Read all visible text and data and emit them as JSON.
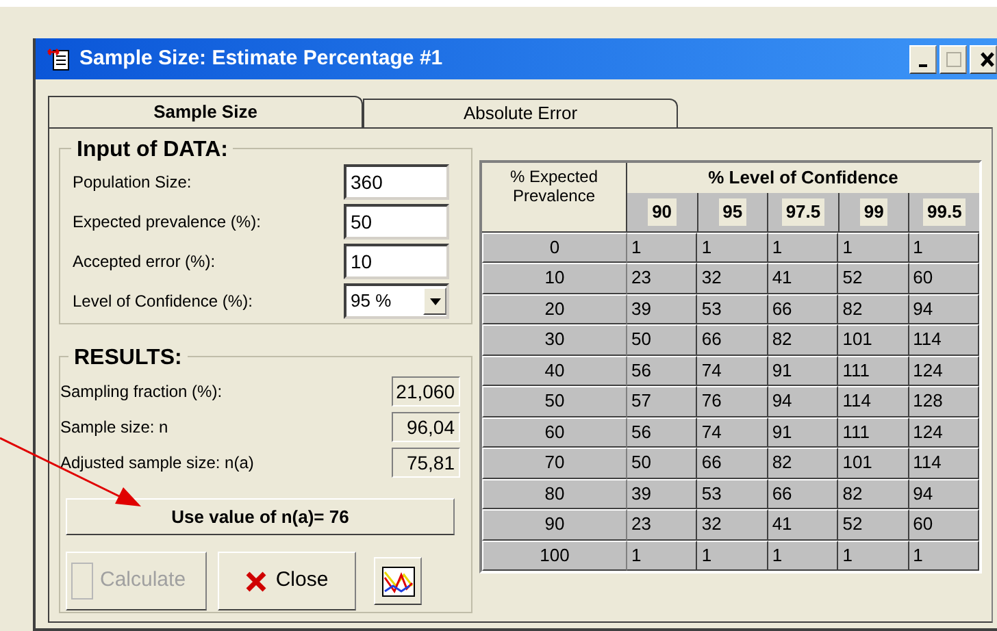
{
  "window": {
    "title": "Sample Size: Estimate Percentage  #1"
  },
  "tabs": [
    {
      "label": "Sample Size",
      "selected": true
    },
    {
      "label": "Absolute Error",
      "selected": false
    }
  ],
  "input": {
    "title": "Input of DATA:",
    "fields": [
      {
        "kind": "text",
        "label": "Population Size:",
        "value": "360"
      },
      {
        "kind": "text",
        "label": "Expected prevalence (%):",
        "value": "50"
      },
      {
        "kind": "text",
        "label": "Accepted error (%):",
        "value": "10"
      },
      {
        "kind": "select",
        "label": "Level of Confidence (%):",
        "value": "95 %"
      }
    ]
  },
  "results": {
    "title": "RESULTS:",
    "rows": [
      {
        "label": "Sampling fraction (%):",
        "value": "21,060"
      },
      {
        "label": "Sample size: n",
        "value": "96,04"
      },
      {
        "label": "Adjusted sample size: n(a)",
        "value": "75,81"
      }
    ],
    "use_button": "Use value of n(a)= 76"
  },
  "buttons": [
    {
      "kind": "calculate",
      "label": "Calculate",
      "disabled": true
    },
    {
      "kind": "close",
      "label": "Close",
      "disabled": false
    },
    {
      "kind": "chart",
      "disabled": false
    }
  ],
  "table": {
    "row_header": "% Expected Prevalence",
    "group_header": "% Level of Confidence",
    "columns": [
      "90",
      "95",
      "97.5",
      "99",
      "99.5"
    ],
    "rows": [
      {
        "prevalence": "0",
        "values": [
          "1",
          "1",
          "1",
          "1",
          "1"
        ]
      },
      {
        "prevalence": "10",
        "values": [
          "23",
          "32",
          "41",
          "52",
          "60"
        ]
      },
      {
        "prevalence": "20",
        "values": [
          "39",
          "53",
          "66",
          "82",
          "94"
        ]
      },
      {
        "prevalence": "30",
        "values": [
          "50",
          "66",
          "82",
          "101",
          "114"
        ]
      },
      {
        "prevalence": "40",
        "values": [
          "56",
          "74",
          "91",
          "111",
          "124"
        ]
      },
      {
        "prevalence": "50",
        "values": [
          "57",
          "76",
          "94",
          "114",
          "128"
        ]
      },
      {
        "prevalence": "60",
        "values": [
          "56",
          "74",
          "91",
          "111",
          "124"
        ]
      },
      {
        "prevalence": "70",
        "values": [
          "50",
          "66",
          "82",
          "101",
          "114"
        ]
      },
      {
        "prevalence": "80",
        "values": [
          "39",
          "53",
          "66",
          "82",
          "94"
        ]
      },
      {
        "prevalence": "90",
        "values": [
          "23",
          "32",
          "41",
          "52",
          "60"
        ]
      },
      {
        "prevalence": "100",
        "values": [
          "1",
          "1",
          "1",
          "1",
          "1"
        ]
      }
    ]
  }
}
